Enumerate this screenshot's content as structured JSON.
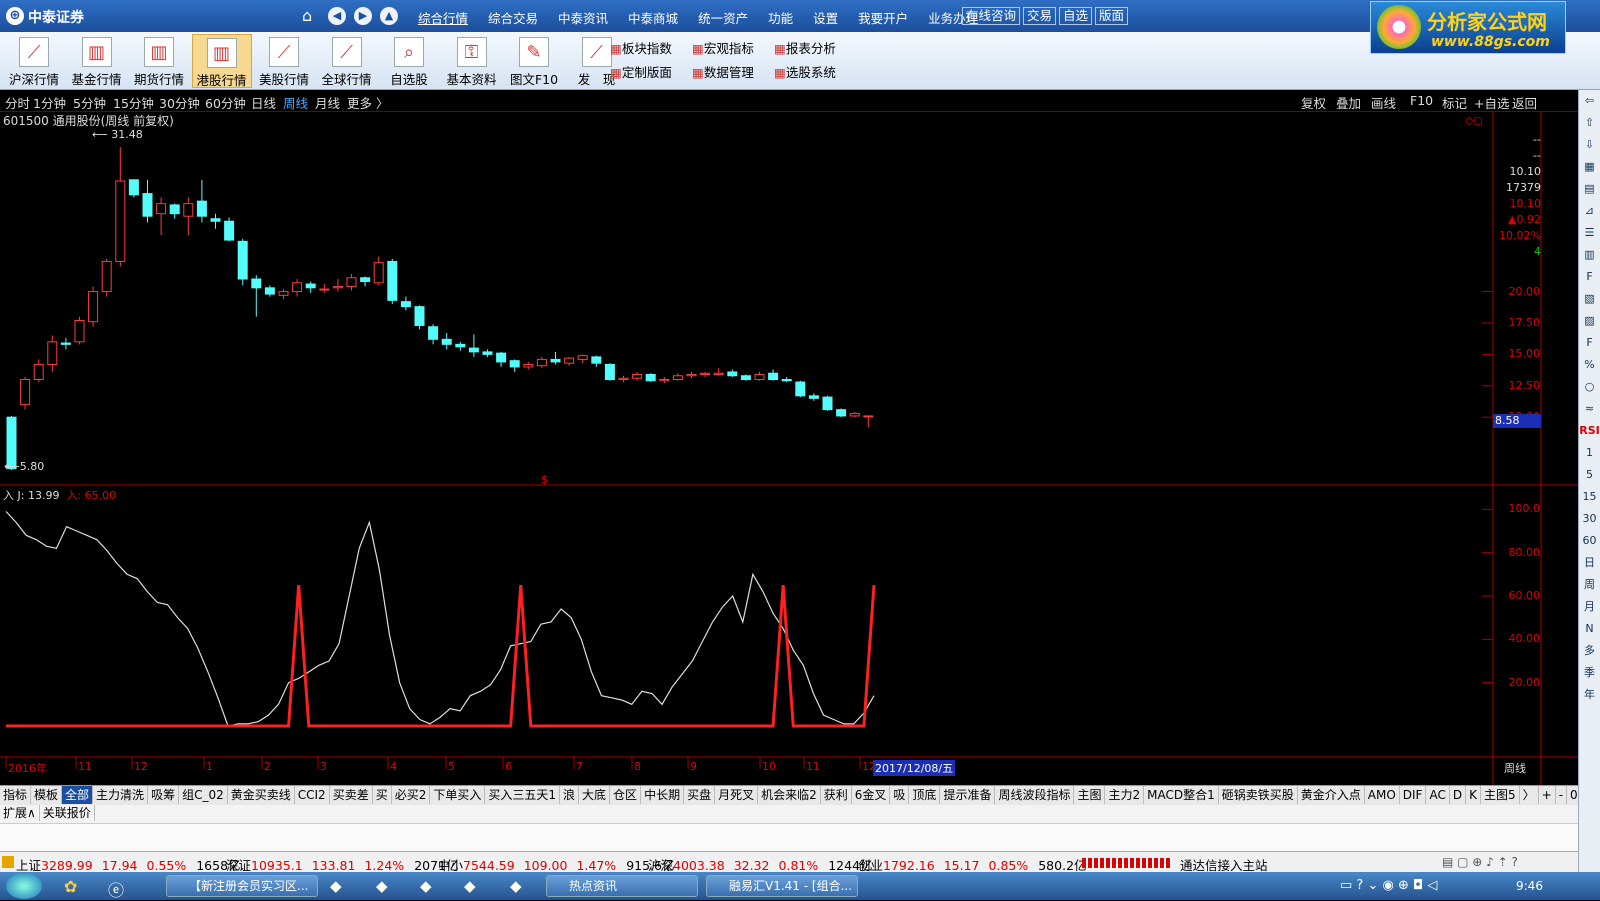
{
  "app": {
    "logo": "中泰证券",
    "watermark_line1": "分析家公式网",
    "watermark_line2": "www.88gs.com"
  },
  "menu": [
    "综合行情",
    "综合交易",
    "中泰资讯",
    "中泰商城",
    "统一资产",
    "功能",
    "设置",
    "我要开户",
    "业务办理"
  ],
  "menu_buttons": [
    "在线咨询",
    "交易",
    "自选",
    "版面"
  ],
  "toolbar": [
    {
      "label": "沪深行情",
      "icon": "line-chart-icon"
    },
    {
      "label": "基金行情",
      "icon": "bar-chart-icon"
    },
    {
      "label": "期货行情",
      "icon": "bar-chart-icon"
    },
    {
      "label": "港股行情",
      "icon": "bar-chart-icon",
      "selected": true
    },
    {
      "label": "美股行情",
      "icon": "line-chart-icon"
    },
    {
      "label": "全球行情",
      "icon": "line-chart-icon"
    },
    {
      "label": "自选股",
      "icon": "search-chart-icon"
    },
    {
      "label": "基本资料",
      "icon": "key-icon"
    },
    {
      "label": "图文F10",
      "icon": "pen-icon"
    },
    {
      "label": "发　现",
      "icon": "line-chart-icon"
    }
  ],
  "toolbar_small": [
    {
      "label": "板块指数"
    },
    {
      "label": "宏观指标"
    },
    {
      "label": "报表分析"
    },
    {
      "label": "定制版面"
    },
    {
      "label": "数据管理"
    },
    {
      "label": "选股系统"
    }
  ],
  "periods": [
    "分时",
    "1分钟",
    "5分钟",
    "15分钟",
    "30分钟",
    "60分钟",
    "日线",
    "周线",
    "月线",
    "更多 〉"
  ],
  "active_period": "周线",
  "period_right": [
    "复权",
    "叠加",
    "画线",
    "F10",
    "标记",
    "+自选",
    "返回"
  ],
  "stock": {
    "title": "601500 通用股份(周线 前复权)",
    "high_label": "31.48",
    "low_label": "5.80",
    "marker": "$"
  },
  "right_info": {
    "v1": "--",
    "v2": "--",
    "v3": "10.10",
    "v4": "17379",
    "v5": "10.10",
    "v6": "▲0.92",
    "v7": "10.02%",
    "v8": "4"
  },
  "price_axis": [
    "20.00",
    "17.50",
    "15.00",
    "12.50",
    "10.00"
  ],
  "current_price": "8.58",
  "indicator": {
    "label_j": "J: 13.99",
    "label_in": "入: 65.00",
    "prefix": "入",
    "axis": [
      "100.0",
      "80.00",
      "60.00",
      "40.00",
      "20.00"
    ]
  },
  "x_axis": {
    "labels": [
      "2016年",
      "11",
      "12",
      "1",
      "2",
      "3",
      "4",
      "5",
      "6",
      "7",
      "8",
      "9",
      "10",
      "11",
      "12"
    ],
    "cursor_date": "2017/12/08/五",
    "period_label": "周线"
  },
  "tabs": [
    "指标",
    "模板",
    "全部",
    "主力清洗",
    "吸筹",
    "组C_02",
    "黄金买卖线",
    "CCI2",
    "买卖差",
    "买",
    "必买2",
    "下单买入",
    "买入三五天1",
    "浪",
    "大底",
    "仓区",
    "中长期",
    "买盘",
    "月死叉",
    "机会来临2",
    "获利",
    "6金叉",
    "吸",
    "顶底",
    "提示准备",
    "周线波段指标",
    "主图",
    "主力2",
    "MACD整合1",
    "砸锅卖铁买股",
    "黄金介入点",
    "AMO",
    "DIF",
    "AC",
    "D",
    "K",
    "主图5",
    "〉",
    "+",
    "-",
    "0"
  ],
  "active_tab": "全部",
  "ext_tabs": [
    "扩展∧",
    "关联报价"
  ],
  "status": [
    {
      "name": "上证",
      "price": "3289.99",
      "chg": "17.94",
      "pct": "0.55%",
      "amt": "1658亿"
    },
    {
      "name": "深证",
      "price": "10935.1",
      "chg": "133.81",
      "pct": "1.24%",
      "amt": "2071亿"
    },
    {
      "name": "中小",
      "price": "7544.59",
      "chg": "109.00",
      "pct": "1.47%",
      "amt": "915.6亿"
    },
    {
      "name": "沪深",
      "price": "4003.38",
      "chg": "32.32",
      "pct": "0.81%",
      "amt": "1244亿"
    },
    {
      "name": "创业",
      "price": "1792.16",
      "chg": "15.17",
      "pct": "0.85%",
      "amt": "580.2亿"
    }
  ],
  "connection": "通达信接入主站",
  "taskbar": {
    "items": [
      "【新注册会员实习区...",
      "热点资讯",
      "融易汇V1.41 - [组合..."
    ],
    "clock": "9:46"
  },
  "rightbar_labels": [
    "RSI",
    "1",
    "5",
    "15",
    "30",
    "60",
    "日",
    "周",
    "月",
    "N",
    "多",
    "季",
    "年"
  ],
  "chart_data": {
    "type": "candlestick",
    "candles": [
      [
        10.0,
        10.1,
        5.8,
        5.9
      ],
      [
        11.0,
        13.2,
        10.6,
        13.0
      ],
      [
        13.0,
        14.6,
        12.8,
        14.2
      ],
      [
        14.2,
        16.5,
        13.6,
        16.0
      ],
      [
        15.9,
        16.3,
        15.4,
        15.8
      ],
      [
        16.0,
        18.0,
        15.8,
        17.7
      ],
      [
        17.6,
        20.4,
        17.2,
        20.0
      ],
      [
        20.0,
        22.6,
        19.6,
        22.4
      ],
      [
        22.4,
        31.5,
        22.0,
        28.8
      ],
      [
        28.9,
        28.9,
        27.5,
        27.7
      ],
      [
        27.8,
        28.9,
        25.5,
        26.0
      ],
      [
        26.2,
        27.5,
        24.5,
        27.0
      ],
      [
        26.9,
        27.0,
        25.8,
        26.2
      ],
      [
        26.0,
        27.5,
        24.5,
        27.0
      ],
      [
        27.2,
        28.9,
        25.5,
        26.0
      ],
      [
        25.8,
        26.2,
        25.0,
        25.6
      ],
      [
        25.6,
        25.9,
        24.0,
        24.1
      ],
      [
        24.0,
        24.2,
        20.5,
        21.0
      ],
      [
        21.0,
        21.3,
        18.0,
        20.3
      ],
      [
        20.3,
        20.5,
        19.6,
        19.8
      ],
      [
        19.7,
        20.2,
        19.4,
        20.0
      ],
      [
        20.0,
        21.0,
        19.6,
        20.7
      ],
      [
        20.6,
        20.8,
        19.9,
        20.3
      ],
      [
        20.2,
        20.6,
        19.9,
        20.2
      ],
      [
        20.3,
        21.0,
        20.0,
        20.4
      ],
      [
        20.4,
        21.4,
        20.1,
        21.1
      ],
      [
        21.1,
        21.2,
        20.4,
        20.8
      ],
      [
        20.7,
        22.8,
        20.5,
        22.3
      ],
      [
        22.4,
        22.6,
        19.0,
        19.3
      ],
      [
        19.2,
        19.6,
        18.5,
        18.8
      ],
      [
        18.8,
        18.9,
        17.0,
        17.3
      ],
      [
        17.2,
        17.4,
        15.8,
        16.2
      ],
      [
        16.2,
        16.7,
        15.4,
        15.8
      ],
      [
        15.8,
        16.0,
        15.3,
        15.6
      ],
      [
        15.5,
        16.6,
        14.8,
        15.2
      ],
      [
        15.2,
        15.4,
        14.8,
        15.0
      ],
      [
        15.1,
        15.2,
        14.0,
        14.4
      ],
      [
        14.5,
        14.6,
        13.6,
        14.0
      ],
      [
        14.0,
        14.4,
        13.8,
        14.2
      ],
      [
        14.1,
        14.8,
        13.9,
        14.6
      ],
      [
        14.6,
        15.2,
        14.2,
        14.4
      ],
      [
        14.3,
        14.8,
        14.1,
        14.7
      ],
      [
        14.6,
        15.0,
        14.3,
        14.9
      ],
      [
        14.8,
        14.9,
        14.0,
        14.3
      ],
      [
        14.2,
        14.3,
        12.9,
        13.0
      ],
      [
        13.0,
        13.3,
        12.8,
        13.1
      ],
      [
        13.1,
        13.6,
        12.9,
        13.4
      ],
      [
        13.4,
        13.5,
        12.8,
        12.9
      ],
      [
        12.9,
        13.2,
        12.7,
        13.0
      ],
      [
        13.0,
        13.5,
        12.9,
        13.3
      ],
      [
        13.3,
        13.6,
        13.1,
        13.4
      ],
      [
        13.4,
        13.6,
        13.2,
        13.5
      ],
      [
        13.4,
        13.9,
        13.3,
        13.5
      ],
      [
        13.6,
        13.8,
        13.2,
        13.3
      ],
      [
        13.3,
        13.4,
        12.9,
        13.0
      ],
      [
        13.0,
        13.6,
        12.9,
        13.4
      ],
      [
        13.5,
        13.8,
        12.9,
        13.0
      ],
      [
        13.0,
        13.2,
        12.8,
        12.9
      ],
      [
        12.8,
        12.9,
        11.6,
        11.7
      ],
      [
        11.7,
        11.9,
        11.3,
        11.5
      ],
      [
        11.6,
        11.7,
        10.5,
        10.6
      ],
      [
        10.6,
        10.7,
        10.0,
        10.1
      ],
      [
        10.1,
        10.4,
        10.0,
        10.3
      ],
      [
        10.1,
        10.1,
        9.2,
        10.1
      ]
    ],
    "price_ylim": [
      5.0,
      33.5
    ],
    "j_line": [
      99,
      94,
      88,
      86,
      83,
      82,
      92,
      90,
      88,
      86,
      81,
      75,
      70,
      68,
      62,
      57,
      56,
      50,
      45,
      36,
      25,
      13,
      0,
      1,
      1,
      2,
      5,
      10,
      20,
      22,
      25,
      28,
      30,
      38,
      60,
      82,
      94,
      72,
      42,
      20,
      8,
      3,
      1,
      4,
      8,
      7,
      14,
      16,
      19,
      26,
      37,
      38,
      39,
      47,
      48,
      54,
      50,
      40,
      25,
      14,
      13,
      12,
      10,
      16,
      15,
      10,
      18,
      24,
      30,
      39,
      48,
      55,
      60,
      48,
      70,
      62,
      52,
      45,
      35,
      28,
      15,
      5,
      3,
      1,
      1,
      6,
      14
    ],
    "in_line": [
      0,
      0,
      0,
      0,
      0,
      0,
      0,
      0,
      0,
      0,
      0,
      0,
      0,
      0,
      0,
      0,
      0,
      0,
      0,
      0,
      0,
      0,
      0,
      0,
      0,
      0,
      0,
      0,
      0,
      65,
      0,
      0,
      0,
      0,
      0,
      0,
      0,
      0,
      0,
      0,
      0,
      0,
      0,
      0,
      0,
      0,
      0,
      0,
      0,
      0,
      0,
      65,
      0,
      0,
      0,
      0,
      0,
      0,
      0,
      0,
      0,
      0,
      0,
      0,
      0,
      0,
      0,
      0,
      0,
      0,
      0,
      0,
      0,
      0,
      0,
      0,
      0,
      65,
      0,
      0,
      0,
      0,
      0,
      0,
      0,
      0,
      65
    ],
    "ind_ylim": [
      -12,
      108
    ]
  }
}
